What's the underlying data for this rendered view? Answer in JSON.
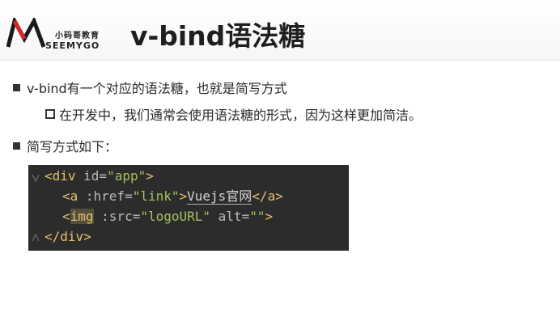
{
  "header": {
    "logo": {
      "cn": "小码哥教育",
      "en": "SEEMYGO"
    },
    "title": "v-bind语法糖"
  },
  "bullets": [
    {
      "text": "v-bind有一个对应的语法糖，也就是简写方式"
    },
    {
      "text": "在开发中，我们通常会使用语法糖的形式，因为这样更加简洁。"
    },
    {
      "text": "简写方式如下："
    }
  ],
  "code": {
    "line1": {
      "open": "<div",
      "attr": " id=",
      "value": "\"app\"",
      "close": ">"
    },
    "line2": {
      "open": "<a",
      "attr": " :href=",
      "value": "\"link\"",
      "close": ">",
      "content": "Vuejs官网",
      "end": "</a>"
    },
    "line3": {
      "open": "<",
      "tagname": "img",
      "attr": " :src=",
      "value": "\"logoURL\"",
      "attr2": " alt=",
      "value2": "\"\"",
      "close": ">"
    },
    "line4": {
      "end": "</div>"
    }
  },
  "colors": {
    "code_background": "#2c2c2c",
    "code_tag": "#e8bf6a",
    "code_string": "#a5c25c",
    "code_attribute": "#bababa"
  }
}
